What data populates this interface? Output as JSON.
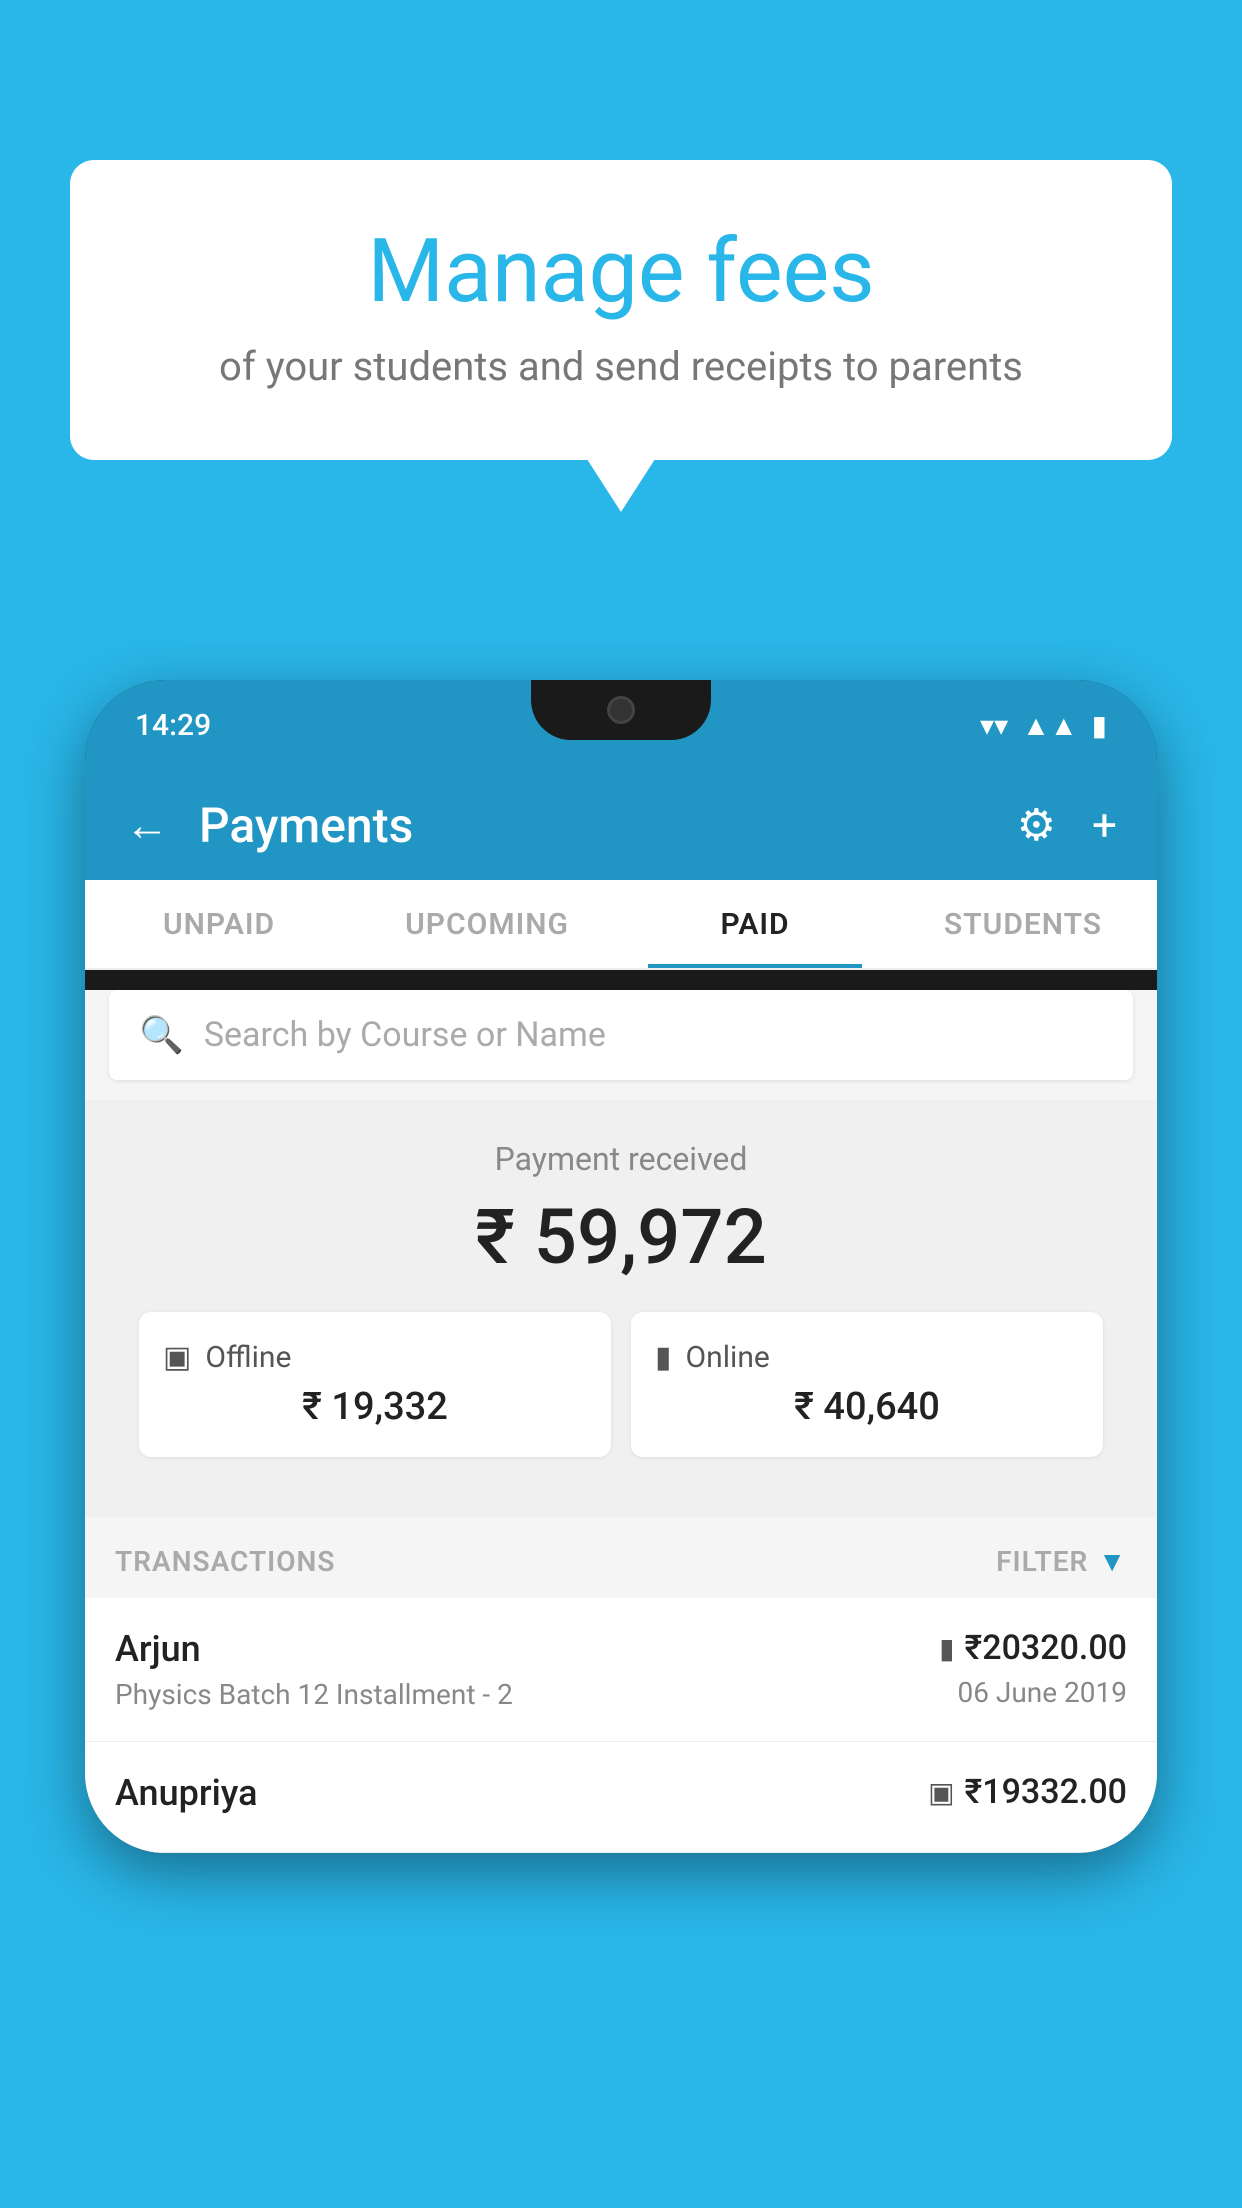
{
  "page": {
    "background_color": "#29b6e8"
  },
  "bubble": {
    "title": "Manage fees",
    "subtitle": "of your students and send receipts to parents"
  },
  "status_bar": {
    "time": "14:29"
  },
  "app_bar": {
    "title": "Payments",
    "back_label": "←",
    "settings_label": "⚙",
    "add_label": "+"
  },
  "tabs": [
    {
      "label": "UNPAID",
      "active": false
    },
    {
      "label": "UPCOMING",
      "active": false
    },
    {
      "label": "PAID",
      "active": true
    },
    {
      "label": "STUDENTS",
      "active": false
    }
  ],
  "search": {
    "placeholder": "Search by Course or Name"
  },
  "payment_section": {
    "label": "Payment received",
    "amount": "₹ 59,972",
    "offline_label": "Offline",
    "offline_amount": "₹ 19,332",
    "online_label": "Online",
    "online_amount": "₹ 40,640"
  },
  "transactions_section": {
    "header": "TRANSACTIONS",
    "filter_label": "FILTER"
  },
  "transactions": [
    {
      "name": "Arjun",
      "course": "Physics Batch 12 Installment - 2",
      "amount": "₹20320.00",
      "date": "06 June 2019",
      "payment_type": "card"
    },
    {
      "name": "Anupriya",
      "course": "",
      "amount": "₹19332.00",
      "date": "",
      "payment_type": "cash"
    }
  ]
}
